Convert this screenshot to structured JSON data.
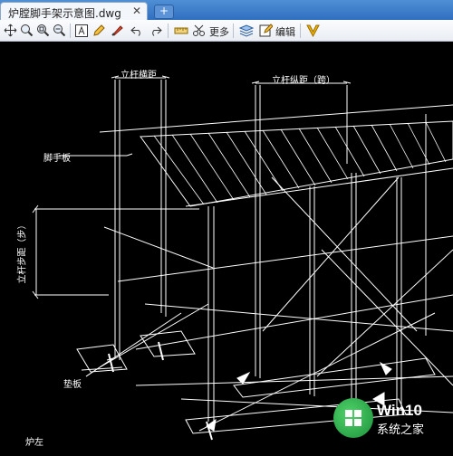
{
  "tab": {
    "title": "炉膛脚手架示意图.dwg",
    "close": "✕"
  },
  "new_tab": "+",
  "toolbar": {
    "more_label": "更多",
    "edit_label": "编辑"
  },
  "drawing": {
    "labels": {
      "pole_transverse": "立杆横距",
      "pole_longitudinal": "立杆纵距（跨）",
      "scaffold_board": "脚手板",
      "pole_step": "立杆步距（步）",
      "pad_board": "垫板",
      "corner": "炉左"
    }
  },
  "watermark": {
    "brand": "Win10",
    "site": "系统之家"
  }
}
